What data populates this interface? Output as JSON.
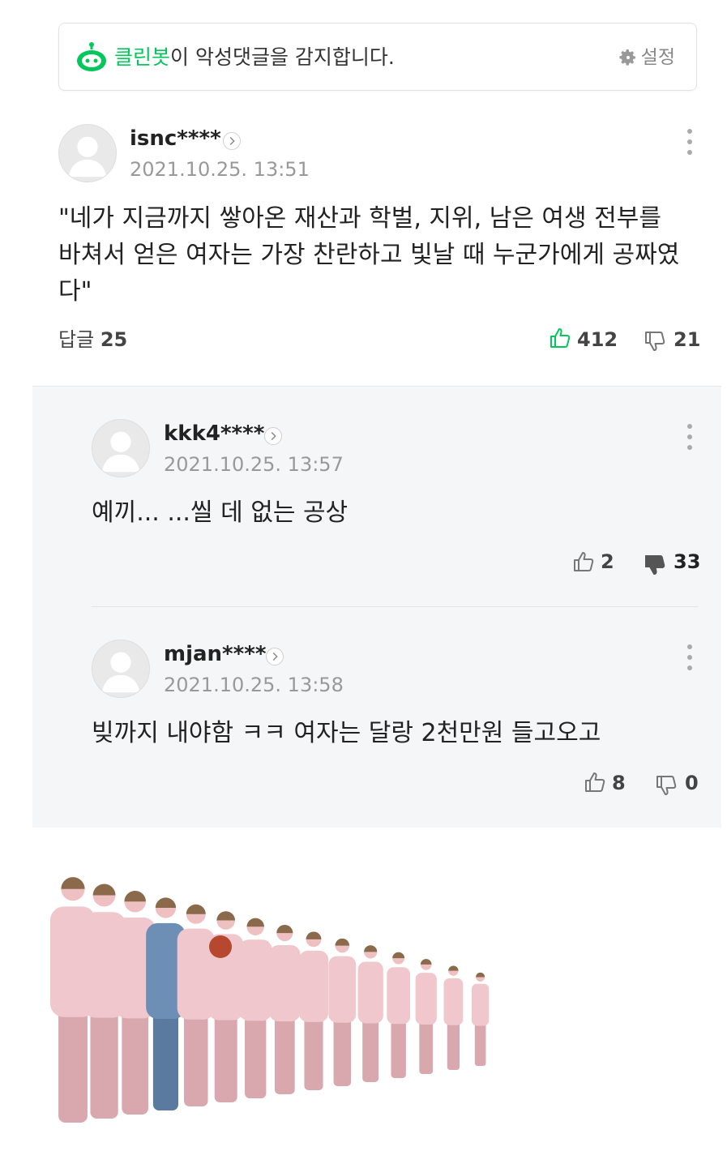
{
  "cleanbot": {
    "brand": "클린봇",
    "message": "이 악성댓글을 감지합니다.",
    "settings_label": "설정",
    "brand_color": "#03c75a"
  },
  "main_comment": {
    "username": "isnc****",
    "date": "2021.10.25. 13:51",
    "text": "\"네가 지금까지 쌓아온 재산과 학벌, 지위, 남은 여생 전부를 바쳐서 얻은 여자는 가장 찬란하고 빛날 때 누군가에게 공짜였다\"",
    "replies_label": "답글",
    "replies_count": "25",
    "likes": "412",
    "dislikes": "21",
    "like_color": "#03c75a"
  },
  "replies": [
    {
      "username": "kkk4****",
      "date": "2021.10.25. 13:57",
      "text": "예끼... ...씰 데 없는 공상",
      "likes": "2",
      "dislikes": "33",
      "disliked_filled": true
    },
    {
      "username": "mjan****",
      "date": "2021.10.25. 13:58",
      "text": "빚까지 내야함 ㅋㅋ 여자는 달랑 2천만원 들고오고",
      "likes": "8",
      "dislikes": "0",
      "disliked_filled": false
    }
  ],
  "icons": [
    "cleanbot-icon",
    "gear-icon",
    "avatar-icon",
    "chevron-right-icon",
    "more-vertical-icon",
    "thumbs-up-icon",
    "thumbs-down-icon"
  ]
}
